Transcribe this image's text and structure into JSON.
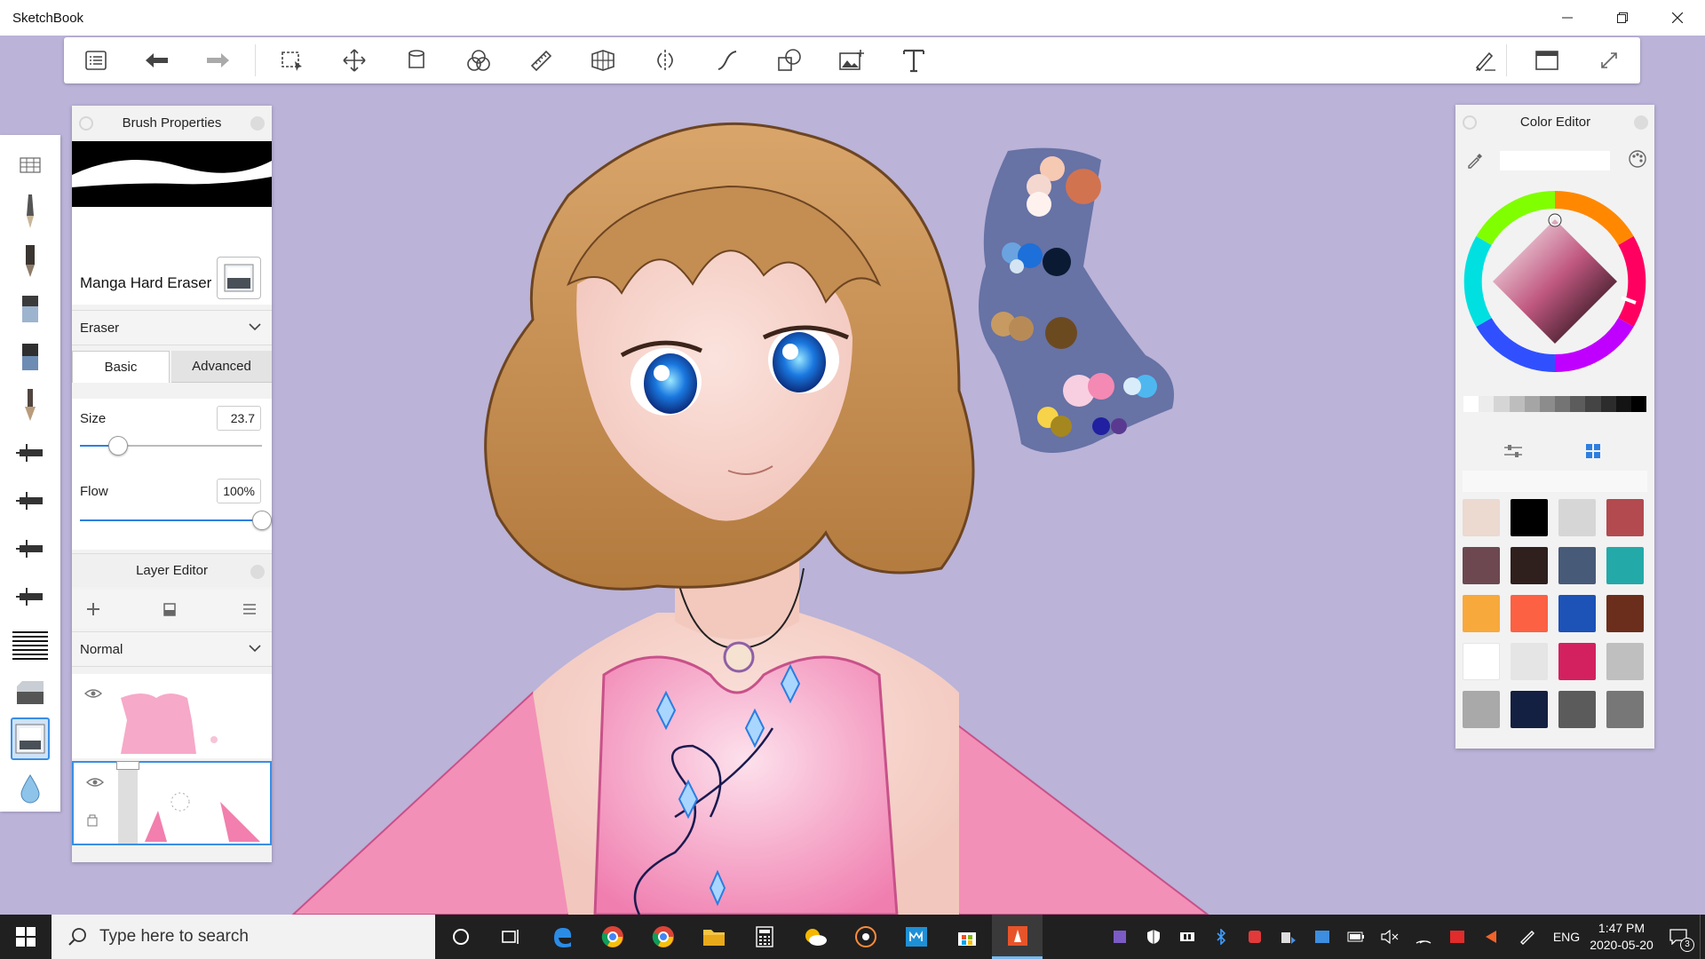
{
  "window": {
    "title": "SketchBook"
  },
  "toolbar": {
    "items": [
      "brush-library",
      "undo",
      "redo",
      "selection",
      "transform",
      "fill",
      "color-blend",
      "ruler",
      "perspective",
      "symmetry",
      "stroke-tools",
      "shapes",
      "add-image",
      "text",
      "pen-mode",
      "window-mode",
      "fullscreen"
    ]
  },
  "brush_panel": {
    "title": "Brush Properties",
    "brush_name": "Manga Hard Eraser",
    "brush_type": "Eraser",
    "tabs": {
      "basic": "Basic",
      "advanced": "Advanced"
    },
    "size": {
      "label": "Size",
      "value": "23.7",
      "fraction": 0.21
    },
    "flow": {
      "label": "Flow",
      "value": "100%",
      "fraction": 1.0
    }
  },
  "layer_editor": {
    "title": "Layer Editor",
    "blend_mode": "Normal",
    "layers": [
      {
        "name": "layer-dress",
        "visible": true,
        "selected": false
      },
      {
        "name": "layer-sleeves",
        "visible": true,
        "selected": true
      }
    ]
  },
  "color_editor": {
    "title": "Color Editor",
    "current_color": "#b8387a",
    "grays": [
      "#ffffff",
      "#ececec",
      "#d5d5d5",
      "#bdbdbd",
      "#a5a5a5",
      "#8c8c8c",
      "#747474",
      "#5c5c5c",
      "#444444",
      "#2c2c2c",
      "#141414",
      "#000000"
    ],
    "swatches": [
      "#ecd9d0",
      "#000000",
      "#d6d6d6",
      "#b24a4f",
      "#6d4850",
      "#2f201e",
      "#475a78",
      "#24a9a9",
      "#f8a93b",
      "#fb6142",
      "#1d52b7",
      "#6c2e1c",
      "#ffffff",
      "#e5e5e5",
      "#d3215f",
      "#bfbfbf",
      "#a9a9a9",
      "#142041",
      "#5b5b5b",
      "#777777"
    ]
  },
  "taskbar": {
    "search_placeholder": "Type here to search",
    "language": "ENG",
    "time": "1:47 PM",
    "date": "2020-05-20",
    "notification_count": "3"
  }
}
